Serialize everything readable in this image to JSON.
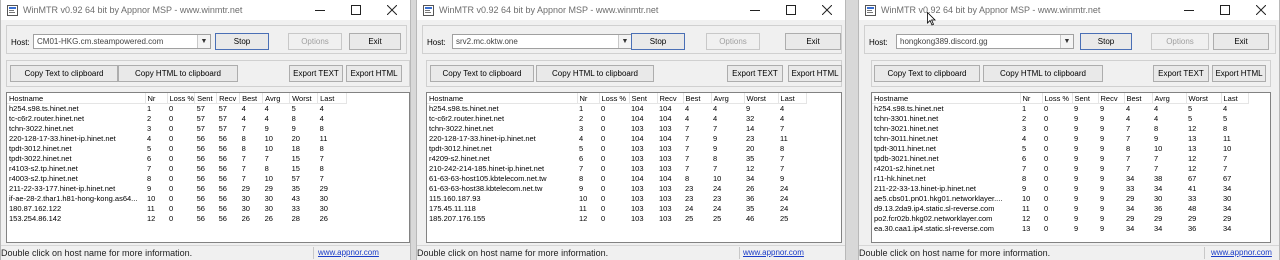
{
  "columns": [
    "Hostname",
    "Nr",
    "Loss %",
    "Sent",
    "Recv",
    "Best",
    "Avrg",
    "Worst",
    "Last"
  ],
  "windows": [
    {
      "title": "WinMTR v0.92 64 bit by Appnor MSP - www.winmtr.net",
      "host_label": "Host:",
      "host": "CM01-HKG.cm.steampowered.com",
      "stop": "Stop",
      "options": "Options",
      "exit": "Exit",
      "copy_text": "Copy Text to clipboard",
      "copy_html": "Copy HTML to clipboard",
      "export_text": "Export TEXT",
      "export_html": "Export HTML",
      "rows": [
        [
          "h254.s98.ts.hinet.net",
          "1",
          "0",
          "57",
          "57",
          "4",
          "4",
          "5",
          "4"
        ],
        [
          "tc-c6r2.router.hinet.net",
          "2",
          "0",
          "57",
          "57",
          "4",
          "4",
          "8",
          "4"
        ],
        [
          "tchn-3022.hinet.net",
          "3",
          "0",
          "57",
          "57",
          "7",
          "9",
          "9",
          "8"
        ],
        [
          "220-128-17-33.hinet-ip.hinet.net",
          "4",
          "0",
          "56",
          "56",
          "8",
          "10",
          "20",
          "11"
        ],
        [
          "tpdt-3012.hinet.net",
          "5",
          "0",
          "56",
          "56",
          "8",
          "10",
          "18",
          "8"
        ],
        [
          "tpdt-3022.hinet.net",
          "6",
          "0",
          "56",
          "56",
          "7",
          "7",
          "15",
          "7"
        ],
        [
          "r4103-s2.tp.hinet.net",
          "7",
          "0",
          "56",
          "56",
          "7",
          "8",
          "15",
          "8"
        ],
        [
          "r4003-s2.tp.hinet.net",
          "8",
          "0",
          "56",
          "56",
          "7",
          "10",
          "57",
          "7"
        ],
        [
          "211-22-33-177.hinet-ip.hinet.net",
          "9",
          "0",
          "56",
          "56",
          "29",
          "29",
          "35",
          "29"
        ],
        [
          "if-ae-28-2.thar1.h81-hong-kong.as64...",
          "10",
          "0",
          "56",
          "56",
          "30",
          "30",
          "43",
          "30"
        ],
        [
          "180.87.162.122",
          "11",
          "0",
          "56",
          "56",
          "30",
          "30",
          "33",
          "30"
        ],
        [
          "153.254.86.142",
          "12",
          "0",
          "56",
          "56",
          "26",
          "26",
          "28",
          "26"
        ]
      ],
      "status": "Double click on host name for more information.",
      "link": "www.appnor.com"
    },
    {
      "title": "WinMTR v0.92 64 bit by Appnor MSP - www.winmtr.net",
      "host_label": "Host:",
      "host": "srv2.mc.oktw.one",
      "stop": "Stop",
      "options": "Options",
      "exit": "Exit",
      "copy_text": "Copy Text to clipboard",
      "copy_html": "Copy HTML to clipboard",
      "export_text": "Export TEXT",
      "export_html": "Export HTML",
      "rows": [
        [
          "h254.s98.ts.hinet.net",
          "1",
          "0",
          "104",
          "104",
          "4",
          "4",
          "9",
          "4"
        ],
        [
          "tc-c6r2.router.hinet.net",
          "2",
          "0",
          "104",
          "104",
          "4",
          "4",
          "32",
          "4"
        ],
        [
          "tchn-3022.hinet.net",
          "3",
          "0",
          "103",
          "103",
          "7",
          "7",
          "14",
          "7"
        ],
        [
          "220-128-17-33.hinet-ip.hinet.net",
          "4",
          "0",
          "104",
          "104",
          "7",
          "9",
          "23",
          "11"
        ],
        [
          "tpdt-3012.hinet.net",
          "5",
          "0",
          "103",
          "103",
          "7",
          "9",
          "20",
          "8"
        ],
        [
          "r4209-s2.hinet.net",
          "6",
          "0",
          "103",
          "103",
          "7",
          "8",
          "35",
          "7"
        ],
        [
          "210-242-214-185.hinet-ip.hinet.net",
          "7",
          "0",
          "103",
          "103",
          "7",
          "7",
          "12",
          "7"
        ],
        [
          "61-63-63-host105.kbtelecom.net.tw",
          "8",
          "0",
          "104",
          "104",
          "8",
          "10",
          "34",
          "9"
        ],
        [
          "61-63-63-host38.kbtelecom.net.tw",
          "9",
          "0",
          "103",
          "103",
          "23",
          "24",
          "26",
          "24"
        ],
        [
          "115.160.187.93",
          "10",
          "0",
          "103",
          "103",
          "23",
          "23",
          "36",
          "24"
        ],
        [
          "175.45.11.118",
          "11",
          "0",
          "103",
          "103",
          "24",
          "24",
          "35",
          "24"
        ],
        [
          "185.207.176.155",
          "12",
          "0",
          "103",
          "103",
          "25",
          "25",
          "46",
          "25"
        ]
      ],
      "status": "Double click on host name for more information.",
      "link": "www.appnor.com"
    },
    {
      "title": "WinMTR v0.92 64 bit by Appnor MSP - www.winmtr.net",
      "host_label": "Host:",
      "host": "hongkong389.discord.gg",
      "stop": "Stop",
      "options": "Options",
      "exit": "Exit",
      "copy_text": "Copy Text to clipboard",
      "copy_html": "Copy HTML to clipboard",
      "export_text": "Export TEXT",
      "export_html": "Export HTML",
      "rows": [
        [
          "h254.s98.ts.hinet.net",
          "1",
          "0",
          "9",
          "9",
          "4",
          "4",
          "5",
          "4"
        ],
        [
          "tchn-3301.hinet.net",
          "2",
          "0",
          "9",
          "9",
          "4",
          "4",
          "5",
          "5"
        ],
        [
          "tchn-3021.hinet.net",
          "3",
          "0",
          "9",
          "9",
          "7",
          "8",
          "12",
          "8"
        ],
        [
          "tchn-3011.hinet.net",
          "4",
          "0",
          "9",
          "9",
          "7",
          "9",
          "13",
          "11"
        ],
        [
          "tpdt-3011.hinet.net",
          "5",
          "0",
          "9",
          "9",
          "8",
          "10",
          "13",
          "10"
        ],
        [
          "tpdb-3021.hinet.net",
          "6",
          "0",
          "9",
          "9",
          "7",
          "7",
          "12",
          "7"
        ],
        [
          "r4201-s2.hinet.net",
          "7",
          "0",
          "9",
          "9",
          "7",
          "7",
          "12",
          "7"
        ],
        [
          "r11-hk.hinet.net",
          "8",
          "0",
          "9",
          "9",
          "34",
          "38",
          "67",
          "67"
        ],
        [
          "211-22-33-13.hinet-ip.hinet.net",
          "9",
          "0",
          "9",
          "9",
          "33",
          "34",
          "41",
          "34"
        ],
        [
          "ae5.cbs01.pn01.hkg01.networklayer....",
          "10",
          "0",
          "9",
          "9",
          "29",
          "30",
          "33",
          "30"
        ],
        [
          "d9.13.2da9.ip4.static.sl-reverse.com",
          "11",
          "0",
          "9",
          "9",
          "34",
          "36",
          "48",
          "34"
        ],
        [
          "po2.fcr02b.hkg02.networklayer.com",
          "12",
          "0",
          "9",
          "9",
          "29",
          "29",
          "29",
          "29"
        ],
        [
          "ea.30.caa1.ip4.static.sl-reverse.com",
          "13",
          "0",
          "9",
          "9",
          "34",
          "34",
          "36",
          "34"
        ]
      ],
      "status": "Double click on host name for more information.",
      "link": "www.appnor.com"
    }
  ]
}
